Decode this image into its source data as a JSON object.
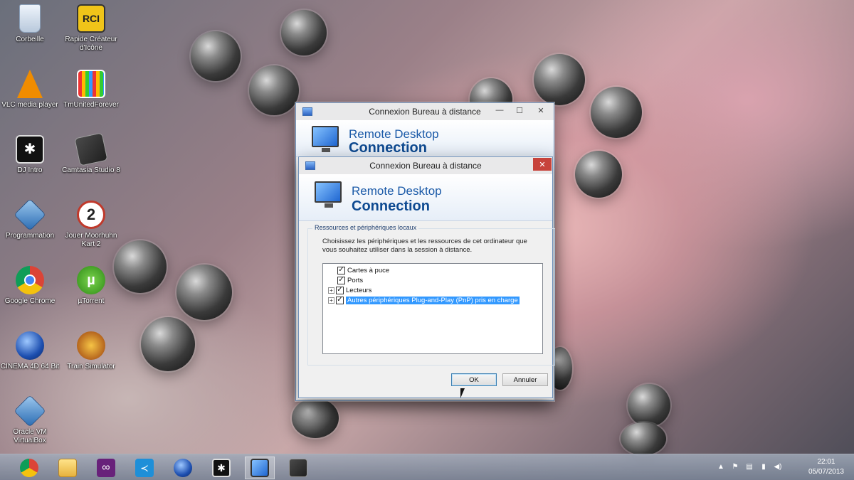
{
  "desktop": {
    "icons": [
      {
        "label": "Corbeille"
      },
      {
        "label": "Rapide Créateur d'Icône",
        "badge": "RCI"
      },
      {
        "label": "VLC media player"
      },
      {
        "label": "TmUnitedForever"
      },
      {
        "label": "DJ Intro"
      },
      {
        "label": "Camtasia Studio 8"
      },
      {
        "label": "Programmation"
      },
      {
        "label": "Jouer Moorhuhn Kart 2",
        "badge": "2"
      },
      {
        "label": "Google Chrome"
      },
      {
        "label": "µTorrent"
      },
      {
        "label": "CINEMA 4D 64 Bit"
      },
      {
        "label": "Train Simulator"
      },
      {
        "label": "Oracle VM VirtualBox"
      }
    ]
  },
  "back_window": {
    "title": "Connexion Bureau à distance",
    "banner_line1": "Remote Desktop",
    "banner_line2": "Connection"
  },
  "dialog": {
    "title": "Connexion Bureau à distance",
    "banner_line1": "Remote Desktop",
    "banner_line2": "Connection",
    "group_label": "Ressources et périphériques locaux",
    "description": "Choisissez les périphériques et les ressources de cet ordinateur que vous souhaitez utiliser dans la session à distance.",
    "tree": [
      {
        "label": "Cartes à puce",
        "checked": true,
        "expandable": false
      },
      {
        "label": "Ports",
        "checked": true,
        "expandable": false
      },
      {
        "label": "Lecteurs",
        "checked": true,
        "expandable": true
      },
      {
        "label": "Autres périphériques Plug-and-Play (PnP) pris en charge",
        "checked": true,
        "expandable": true,
        "selected": true
      }
    ],
    "ok_label": "OK",
    "cancel_label": "Annuler"
  },
  "taskbar": {
    "apps": [
      "Google Chrome",
      "Explorateur de fichiers",
      "Visual Studio",
      "Visual Studio Code",
      "CINEMA 4D",
      "DJ Intro",
      "Connexion Bureau à distance",
      "Camtasia"
    ],
    "time": "22:01",
    "date": "05/07/2013"
  }
}
